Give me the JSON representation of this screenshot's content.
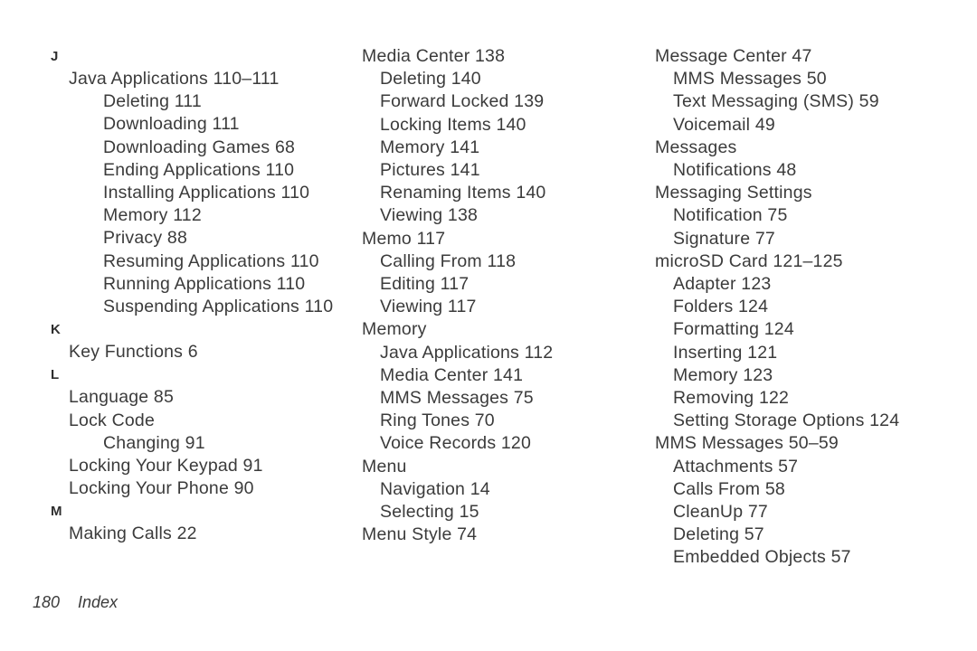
{
  "document": {
    "kind": "index-page",
    "footer": {
      "page_number": "180",
      "label": "Index"
    }
  },
  "columns": [
    {
      "id": "column-1",
      "entries": [
        {
          "text": "J",
          "level": "letter"
        },
        {
          "text": "Java Applications 110–111",
          "level": 1
        },
        {
          "text": "Deleting 111",
          "level": 2
        },
        {
          "text": "Downloading 111",
          "level": 2
        },
        {
          "text": "Downloading Games 68",
          "level": 2
        },
        {
          "text": "Ending Applications 110",
          "level": 2
        },
        {
          "text": "Installing Applications 110",
          "level": 2
        },
        {
          "text": "Memory 112",
          "level": 2
        },
        {
          "text": "Privacy 88",
          "level": 2
        },
        {
          "text": "Resuming Applications 110",
          "level": 2
        },
        {
          "text": "Running Applications 110",
          "level": 2
        },
        {
          "text": "Suspending Applications 110",
          "level": 2
        },
        {
          "text": "K",
          "level": "letter"
        },
        {
          "text": "Key Functions 6",
          "level": 1
        },
        {
          "text": "L",
          "level": "letter"
        },
        {
          "text": "Language 85",
          "level": 1
        },
        {
          "text": "Lock Code",
          "level": 1
        },
        {
          "text": "Changing 91",
          "level": 2
        },
        {
          "text": "Locking Your Keypad 91",
          "level": 1
        },
        {
          "text": "Locking Your Phone 90",
          "level": 1
        },
        {
          "text": "M",
          "level": "letter"
        },
        {
          "text": "Making Calls 22",
          "level": 1
        }
      ]
    },
    {
      "id": "column-2",
      "entries": [
        {
          "text": "Media Center 138",
          "level": 0
        },
        {
          "text": "Deleting 140",
          "level": 1
        },
        {
          "text": "Forward Locked 139",
          "level": 1
        },
        {
          "text": "Locking Items 140",
          "level": 1
        },
        {
          "text": "Memory 141",
          "level": 1
        },
        {
          "text": "Pictures 141",
          "level": 1
        },
        {
          "text": "Renaming Items 140",
          "level": 1
        },
        {
          "text": "Viewing 138",
          "level": 1
        },
        {
          "text": "Memo 117",
          "level": 0
        },
        {
          "text": "Calling From 118",
          "level": 1
        },
        {
          "text": "Editing 117",
          "level": 1
        },
        {
          "text": "Viewing 117",
          "level": 1
        },
        {
          "text": "Memory",
          "level": 0
        },
        {
          "text": "Java Applications 112",
          "level": 1
        },
        {
          "text": "Media Center 141",
          "level": 1
        },
        {
          "text": "MMS Messages 75",
          "level": 1
        },
        {
          "text": "Ring Tones 70",
          "level": 1
        },
        {
          "text": "Voice Records 120",
          "level": 1
        },
        {
          "text": "Menu",
          "level": 0
        },
        {
          "text": "Navigation 14",
          "level": 1
        },
        {
          "text": "Selecting 15",
          "level": 1
        },
        {
          "text": "Menu Style 74",
          "level": 0
        }
      ]
    },
    {
      "id": "column-3",
      "entries": [
        {
          "text": "Message Center 47",
          "level": 0
        },
        {
          "text": "MMS Messages 50",
          "level": 1
        },
        {
          "text": "Text Messaging (SMS) 59",
          "level": 1
        },
        {
          "text": "Voicemail 49",
          "level": 1
        },
        {
          "text": "Messages",
          "level": 0
        },
        {
          "text": "Notifications 48",
          "level": 1
        },
        {
          "text": "Messaging Settings",
          "level": 0
        },
        {
          "text": "Notification 75",
          "level": 1
        },
        {
          "text": "Signature 77",
          "level": 1
        },
        {
          "text": "microSD Card 121–125",
          "level": 0
        },
        {
          "text": "Adapter 123",
          "level": 1
        },
        {
          "text": "Folders 124",
          "level": 1
        },
        {
          "text": "Formatting 124",
          "level": 1
        },
        {
          "text": "Inserting 121",
          "level": 1
        },
        {
          "text": "Memory 123",
          "level": 1
        },
        {
          "text": "Removing 122",
          "level": 1
        },
        {
          "text": "Setting Storage Options 124",
          "level": 1
        },
        {
          "text": "MMS Messages 50–59",
          "level": 0
        },
        {
          "text": "Attachments 57",
          "level": 1
        },
        {
          "text": "Calls From 58",
          "level": 1
        },
        {
          "text": "CleanUp 77",
          "level": 1
        },
        {
          "text": "Deleting 57",
          "level": 1
        },
        {
          "text": "Embedded Objects 57",
          "level": 1
        }
      ]
    }
  ]
}
